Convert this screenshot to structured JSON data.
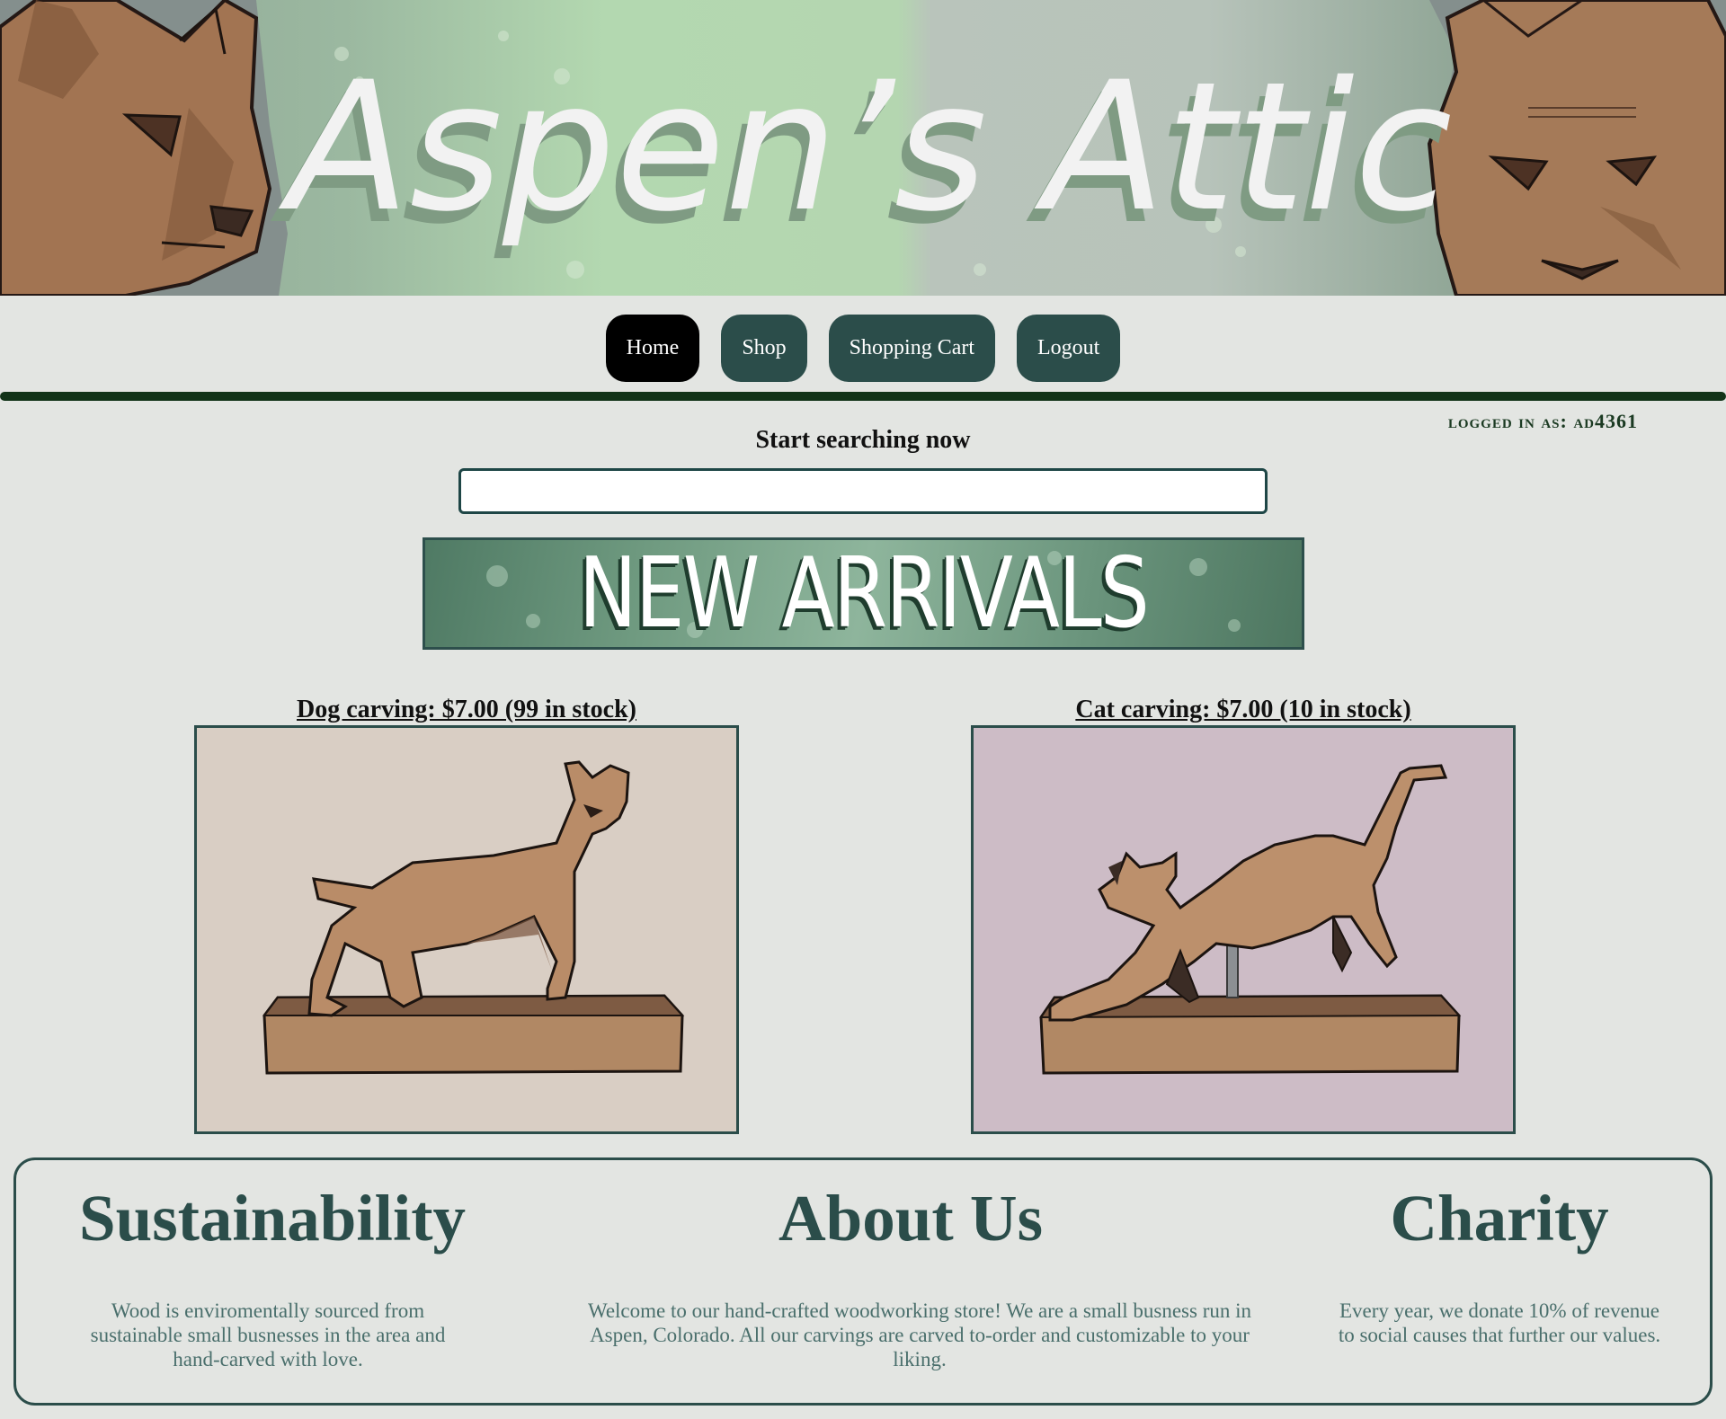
{
  "header": {
    "title": "Aspen’s Attic"
  },
  "nav": {
    "items": [
      {
        "label": "Home",
        "active": true
      },
      {
        "label": "Shop",
        "active": false
      },
      {
        "label": "Shopping Cart",
        "active": false
      },
      {
        "label": "Logout",
        "active": false
      }
    ]
  },
  "user": {
    "logged_in_label": "logged in as:",
    "username": "ad4361"
  },
  "search": {
    "label": "Start searching now",
    "value": "",
    "placeholder": ""
  },
  "banner": {
    "new_arrivals": "NEW ARRIVALS"
  },
  "products": [
    {
      "title": "Dog carving: $7.00 (99 in stock)",
      "name": "Dog carving",
      "price": "$7.00",
      "stock": "99 in stock",
      "bg_color": "#d9cec4"
    },
    {
      "title": "Cat carving: $7.00 (10 in stock)",
      "name": "Cat carving",
      "price": "$7.00",
      "stock": "10 in stock",
      "bg_color": "#cdbcc6"
    }
  ],
  "info": {
    "sustainability": {
      "title": "Sustainability",
      "text": "Wood is enviromentally sourced from sustainable small busnesses in the area and hand-carved with love."
    },
    "about": {
      "title": "About Us",
      "text": "Welcome to our hand-crafted woodworking store! We are a small busness run in Aspen, Colorado. All our carvings are carved to-order and customizable to your liking."
    },
    "charity": {
      "title": "Charity",
      "text": "Every year, we donate 10% of revenue to social causes that further our values."
    }
  },
  "colors": {
    "page_bg": "#e3e5e2",
    "primary": "#2b4d4a",
    "nav_active": "#000000",
    "rule": "#123318"
  }
}
